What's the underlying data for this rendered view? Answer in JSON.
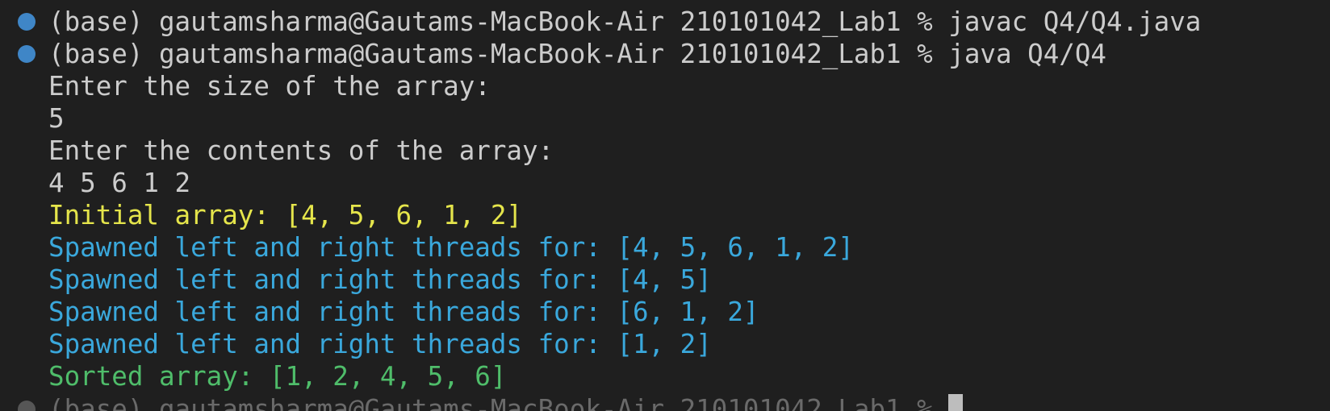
{
  "terminal": {
    "command1": "(base) gautamsharma@Gautams-MacBook-Air 210101042_Lab1 % javac Q4/Q4.java",
    "command2": "(base) gautamsharma@Gautams-MacBook-Air 210101042_Lab1 % java Q4/Q4",
    "output": {
      "prompt_size": "Enter the size of the array:",
      "input_size": "5",
      "prompt_contents": "Enter the contents of the array:",
      "input_contents": "4 5 6 1 2",
      "initial_array": "Initial array: [4, 5, 6, 1, 2]",
      "spawned": [
        "Spawned left and right threads for: [4, 5, 6, 1, 2]",
        "Spawned left and right threads for: [4, 5]",
        "Spawned left and right threads for: [6, 1, 2]",
        "Spawned left and right threads for: [1, 2]"
      ],
      "sorted_array": "Sorted array: [1, 2, 4, 5, 6]"
    },
    "next_prompt": "(base) gautamsharma@Gautams-MacBook-Air 210101042_Lab1 % ",
    "colors": {
      "background": "#1f1f1f",
      "text": "#cccccc",
      "success_dot": "#3f86c7",
      "yellow": "#e5e54b",
      "blue": "#3aa8dc",
      "green": "#4fbd6a"
    }
  }
}
